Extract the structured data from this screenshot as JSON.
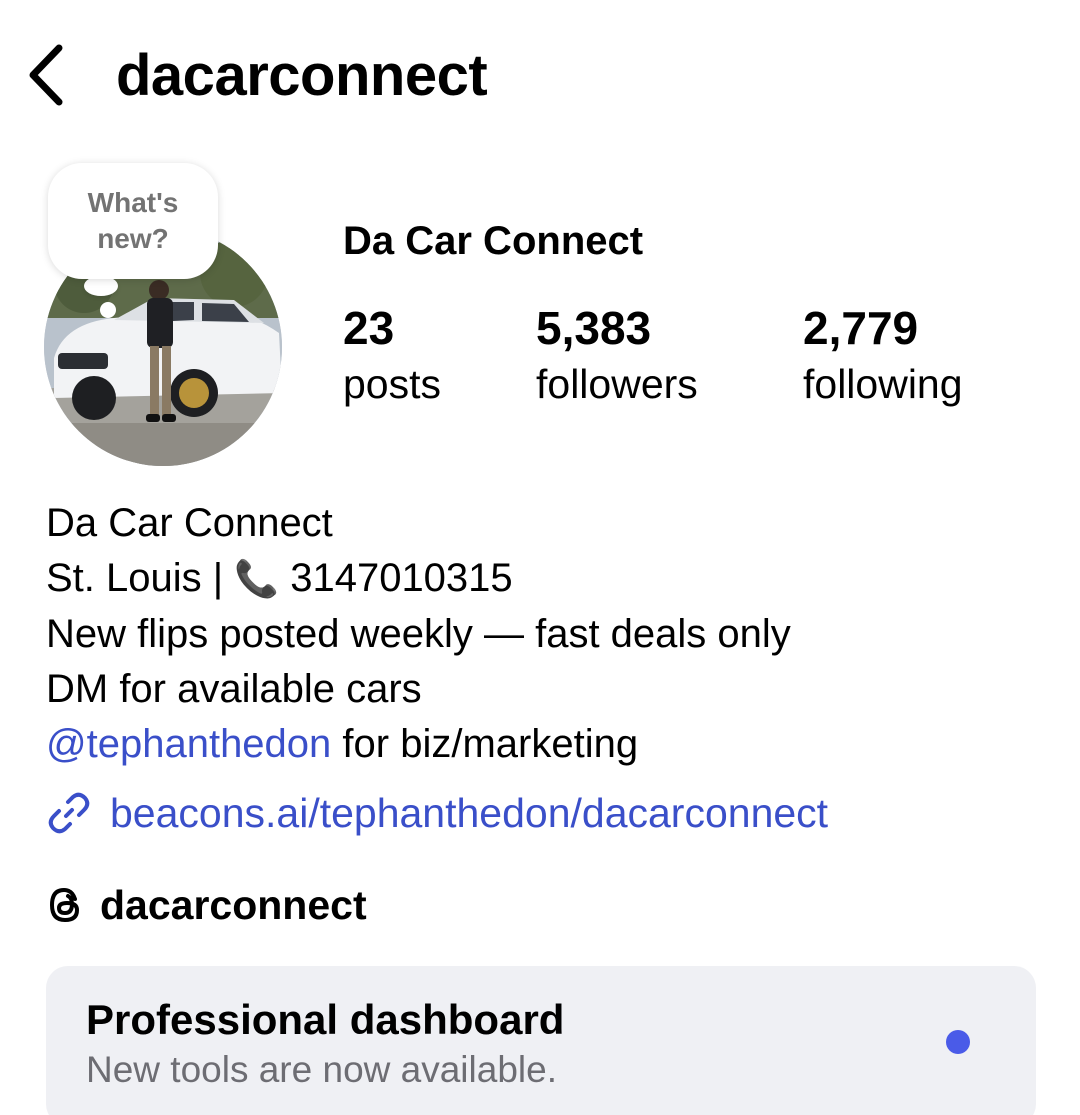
{
  "header": {
    "username": "dacarconnect",
    "back_icon": "chevron-left-icon"
  },
  "note": {
    "text_line1": "What's",
    "text_line2": "new?"
  },
  "profile": {
    "display_name": "Da Car Connect",
    "stats": {
      "posts_count": "23",
      "posts_label": "posts",
      "followers_count": "5,383",
      "followers_label": "followers",
      "following_count": "2,779",
      "following_label": "following"
    }
  },
  "bio": {
    "line1": "Da Car Connect",
    "line2_prefix": "St. Louis | ",
    "line2_phone_icon": "📞",
    "line2_number": " 3147010315",
    "line3": "New flips posted weekly — fast deals only",
    "line4": "DM for available cars",
    "line5_mention": "@tephanthedon",
    "line5_rest": " for biz/marketing"
  },
  "link": {
    "url_text": "beacons.ai/tephanthedon/dacarconnect",
    "icon": "link-icon"
  },
  "threads": {
    "handle": "dacarconnect",
    "icon": "threads-icon"
  },
  "dashboard": {
    "title": "Professional dashboard",
    "subtitle": "New tools are now available."
  },
  "colors": {
    "link_blue": "#3a4fc9",
    "dot_blue": "#4a5be8",
    "card_bg": "#eff0f4",
    "muted_text": "#6d6d73"
  }
}
